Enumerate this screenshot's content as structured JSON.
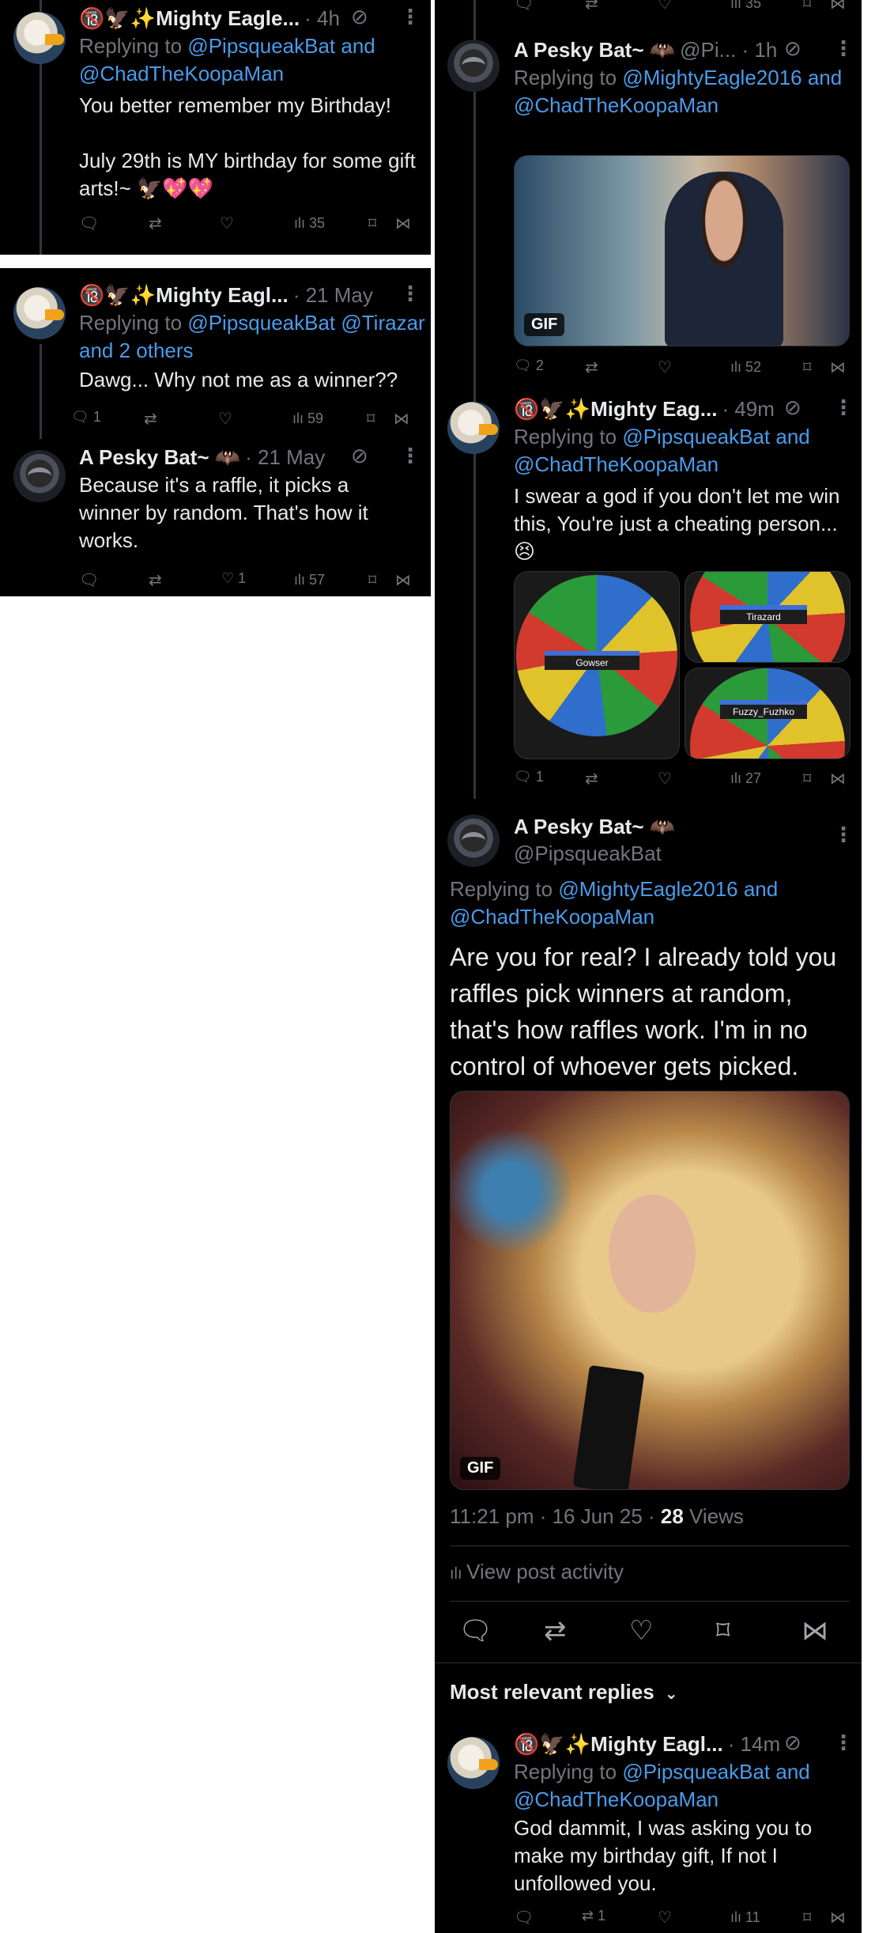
{
  "colors": {
    "background": "#000000",
    "link": "#4a9bea",
    "secondary": "#71767b",
    "text": "#e7e9ea"
  },
  "icons": {
    "reply": "speech-bubble",
    "retweet": "retweet-arrows",
    "like": "heart",
    "views": "bar-chart",
    "bookmark": "bookmark",
    "share": "share-nodes",
    "mute": "muted-circle",
    "more": "three-dots-vertical"
  },
  "panel1": {
    "emoji_prefix": "🔞🦅✨",
    "name": "Mighty Eagle...",
    "meta": "· 4h",
    "replying_prefix": "Replying to ",
    "replying_link": "@PipsqueakBat and @ChadTheKoopaMan",
    "text": "You better remember my Birthday!\n\nJuly 29th is MY birthday for some gift arts!~ 🦅💖💖",
    "views": "35"
  },
  "panel2": {
    "tweet1": {
      "emoji_prefix": "🔞🦅✨",
      "name": "Mighty Eagl...",
      "meta": "· 21 May",
      "replying_prefix": "Replying to ",
      "replying_link_1": "@PipsqueakBat @Tirazar",
      "replying_link_2": "and 2 others",
      "text": "Dawg... Why not me as a winner??",
      "replies": "1",
      "views": "59"
    },
    "tweet2": {
      "name": "A Pesky Bat~ 🦇",
      "meta": "· 21 May",
      "text": "Because it's a raffle, it picks a winner by random. That's how it works.",
      "likes": "1",
      "views": "57"
    }
  },
  "panel3": {
    "top_views": "35",
    "tweet1": {
      "name": "A Pesky Bat~ 🦇",
      "meta": "@Pi... · 1h",
      "replying_prefix": "Replying to ",
      "replying_link": "@MightyEagle2016 and @ChadTheKoopaMan",
      "gif_label": "GIF",
      "replies": "2",
      "views": "52"
    },
    "tweet2": {
      "emoji_prefix": "🔞🦅✨",
      "name": "Mighty Eag...",
      "meta": "· 49m",
      "replying_prefix": "Replying to ",
      "replying_link": "@PipsqueakBat and @ChadTheKoopaMan",
      "text": "I swear a god if you don't let me win this, You're just a cheating person... 😣",
      "wheel_labels": [
        "Gowser",
        "Tirazard",
        "Fuzzy_Fuzhko"
      ],
      "replies": "1",
      "views": "27"
    },
    "main": {
      "name": "A Pesky Bat~ 🦇",
      "handle": "@PipsqueakBat",
      "replying_prefix": "Replying to ",
      "replying_link": "@MightyEagle2016 and @ChadTheKoopaMan",
      "text": "Are you for real? I already told you raffles pick winners at random, that's how raffles work. I'm in no control of whoever gets picked.",
      "gif_label": "GIF",
      "timestamp": "11:21 pm · 16 Jun 25 · ",
      "views_count": "28",
      "views_label": " Views",
      "post_activity": "View post activity"
    },
    "relevant_label": "Most relevant replies",
    "reply": {
      "emoji_prefix": "🔞🦅✨",
      "name": "Mighty Eagl...",
      "meta": "· 14m",
      "replying_prefix": "Replying to ",
      "replying_link": "@PipsqueakBat and @ChadTheKoopaMan",
      "text": "God dammit, I was asking you to make my birthday gift, If not I unfollowed you.",
      "retweets": "1",
      "views": "11"
    }
  }
}
